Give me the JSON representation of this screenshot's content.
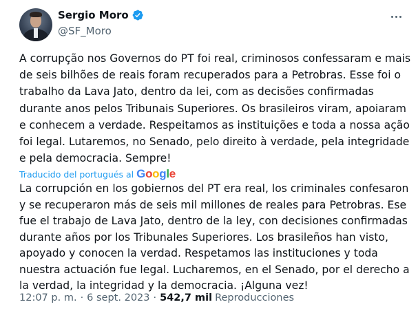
{
  "author": {
    "display_name": "Sergio Moro",
    "handle": "@SF_Moro",
    "verified_icon": "verified-badge-icon"
  },
  "tweet": {
    "text": "A corrupção nos Governos do PT foi real, criminosos confessaram e mais\nde seis bilhões de reais foram recuperados para a Petrobras. Esse foi o\ntrabalho da Lava Jato, dentro da lei, com as decisões confirmadas\ndurante anos pelos Tribunais Superiores. Os brasileiros viram, apoiaram\ne conhecem a verdade. Respeitamos as instituições e toda a nossa ação\nfoi legal. Lutaremos, no Senado, pelo direito à verdade, pela integridade\ne pela democracia. Sempre!",
    "translation_label": "Traducido del portugués al",
    "translation_provider": "Google",
    "translated_text": "La corrupción en los gobiernos del PT era real, los criminales confesaron\ny se recuperaron más de seis mil millones de reales para Petrobras. Ese\nfue el trabajo de Lava Jato, dentro de la ley, con decisiones confirmadas\ndurante años por los Tribunales Superiores. Los brasileños han visto,\napoyado y conocen la verdad. Respetamos las instituciones y toda\nnuestra actuación fue legal. Lucharemos, en el Senado, por el derecho a\nla verdad, la integridad y la democracia. ¡Alguna vez!",
    "time": "12:07 p. m.",
    "date": "6 sept. 2023",
    "separator": "·",
    "views_count": "542,7 mil",
    "views_label": "Reproducciones"
  },
  "colors": {
    "accent": "#1d9bf0",
    "secondary_text": "#536471",
    "primary_text": "#0f1419"
  }
}
